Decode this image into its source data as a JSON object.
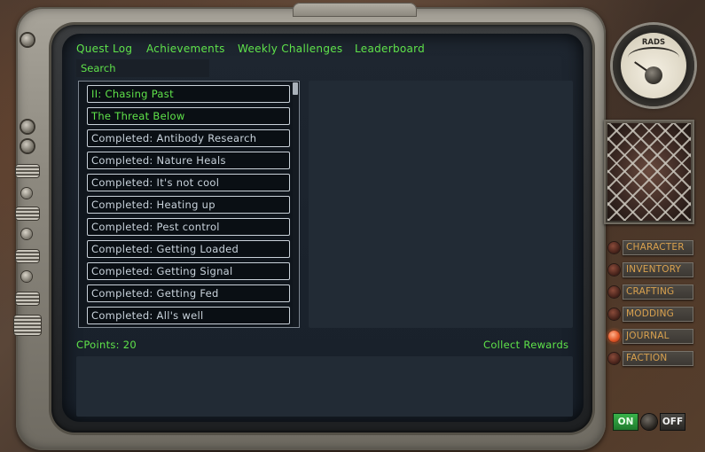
{
  "tabs": [
    {
      "label": "Quest Log"
    },
    {
      "label": "Achievements"
    },
    {
      "label": "Weekly Challenges"
    },
    {
      "label": "Leaderboard"
    }
  ],
  "search": {
    "placeholder": "Search"
  },
  "quests": [
    {
      "label": "II: Chasing Past",
      "status": "active"
    },
    {
      "label": "The Threat Below",
      "status": "active"
    },
    {
      "label": "Completed: Antibody Research",
      "status": "done"
    },
    {
      "label": "Completed: Nature Heals",
      "status": "done"
    },
    {
      "label": "Completed: It's not cool",
      "status": "done"
    },
    {
      "label": "Completed: Heating up",
      "status": "done"
    },
    {
      "label": "Completed: Pest control",
      "status": "done"
    },
    {
      "label": "Completed: Getting Loaded",
      "status": "done"
    },
    {
      "label": "Completed: Getting Signal",
      "status": "done"
    },
    {
      "label": "Completed: Getting Fed",
      "status": "done"
    },
    {
      "label": "Completed: All's well",
      "status": "done"
    }
  ],
  "footer": {
    "cpoints": "CPoints: 20",
    "collect": "Collect Rewards"
  },
  "gauge": {
    "label": "RADS"
  },
  "nav": [
    {
      "label": "CHARACTER",
      "active": false
    },
    {
      "label": "INVENTORY",
      "active": false
    },
    {
      "label": "CRAFTING",
      "active": false
    },
    {
      "label": "MODDING",
      "active": false
    },
    {
      "label": "JOURNAL",
      "active": true
    },
    {
      "label": "FACTION",
      "active": false
    }
  ],
  "power": {
    "on_label": "ON",
    "off_label": "OFF"
  },
  "colors": {
    "terminal_green": "#5fe34a",
    "nav_text": "#d9a14e",
    "active_led": "#e45a2a",
    "screen_bg": "#1e2630"
  }
}
